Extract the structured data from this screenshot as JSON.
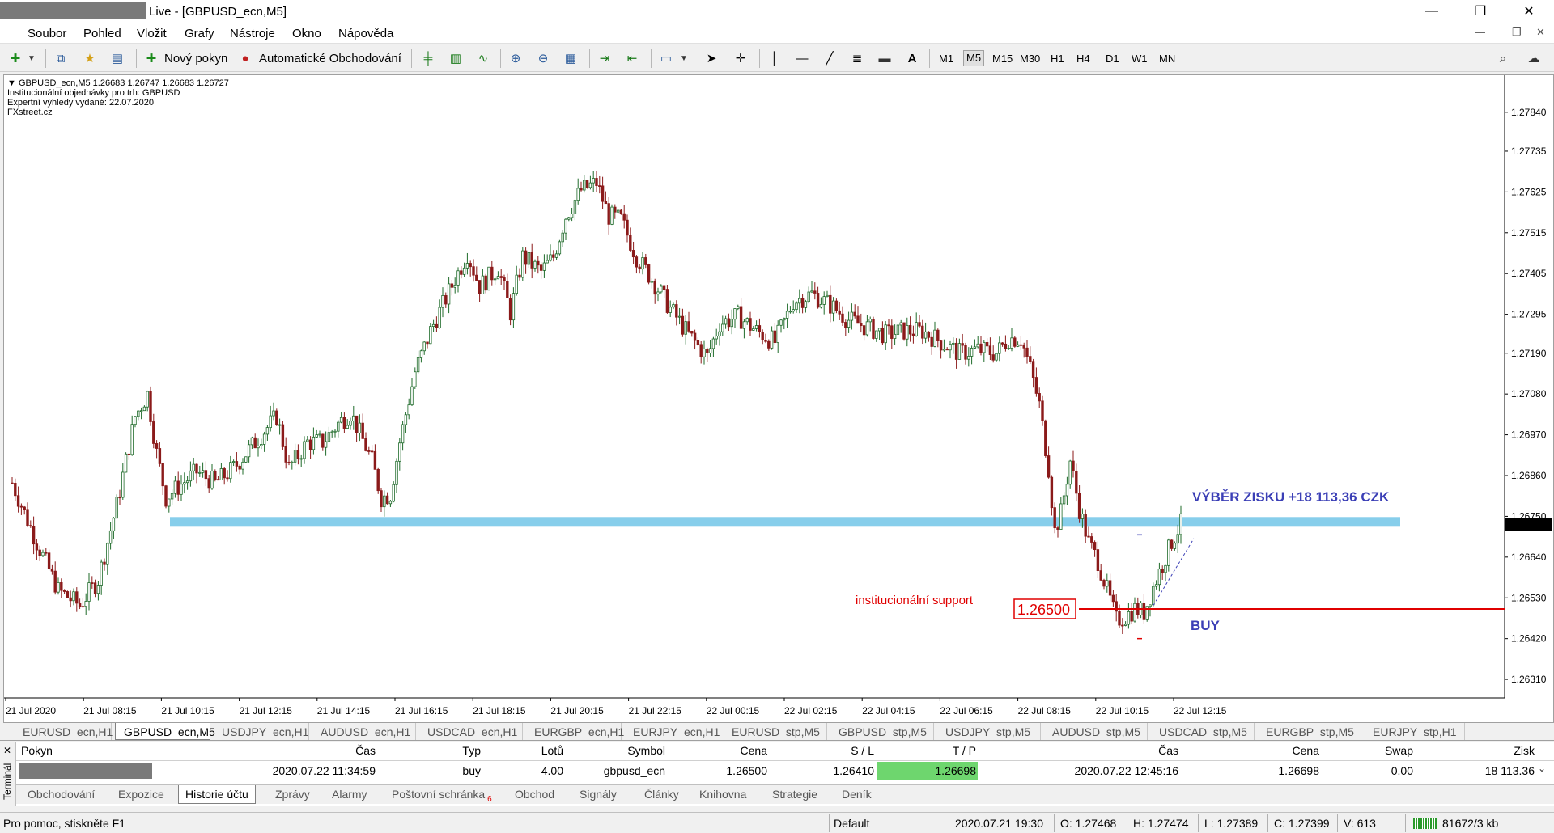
{
  "window": {
    "title": "Live - [GBPUSD_ecn,M5]",
    "minimize": "—",
    "restore": "❐",
    "close": "✕"
  },
  "menu": {
    "items": [
      "Soubor",
      "Pohled",
      "Vložit",
      "Grafy",
      "Nástroje",
      "Okno",
      "Nápověda"
    ],
    "mdi": [
      "—",
      "❐",
      "✕"
    ]
  },
  "toolbar": {
    "new_order": "Nový pokyn",
    "auto_trading": "Automatické Obchodování",
    "timeframes": [
      "M1",
      "M5",
      "M15",
      "M30",
      "H1",
      "H4",
      "D1",
      "W1",
      "MN"
    ],
    "active_timeframe": "M5",
    "text_tool": "A"
  },
  "chart": {
    "header": "GBPUSD_ecn,M5  1.26683 1.26747 1.26683 1.26727",
    "info_lines": [
      "Institucionální objednávky pro trh: GBPUSD",
      "Expertní výhledy vydané: 22.07.2020",
      "FXstreet.cz"
    ],
    "current_price": "1.26727",
    "support_label": "institucionální support",
    "support_price": "1.26500",
    "buy_label": "BUY",
    "profit_label": "VÝBĚR ZISKU +18 113,36 CZK",
    "colors": {
      "bull": "#1f6b2a",
      "bear": "#8b1a1a",
      "support_line": "#e00000",
      "zone": "#87ceeb",
      "annotation_blue": "#3b3fb6"
    }
  },
  "chart_data": {
    "type": "candlestick",
    "symbol": "GBPUSD_ecn",
    "timeframe": "M5",
    "ylim": [
      1.2626,
      1.2794
    ],
    "y_ticks": [
      "1.27840",
      "1.27735",
      "1.27625",
      "1.27515",
      "1.27405",
      "1.27295",
      "1.27190",
      "1.27080",
      "1.26970",
      "1.26860",
      "1.26750",
      "1.26640",
      "1.26530",
      "1.26420",
      "1.26310"
    ],
    "x_ticks": [
      "21 Jul 2020",
      "21 Jul 08:15",
      "21 Jul 10:15",
      "21 Jul 12:15",
      "21 Jul 14:15",
      "21 Jul 16:15",
      "21 Jul 18:15",
      "21 Jul 20:15",
      "21 Jul 22:15",
      "22 Jul 00:15",
      "22 Jul 02:15",
      "22 Jul 04:15",
      "22 Jul 06:15",
      "22 Jul 08:15",
      "22 Jul 10:15",
      "22 Jul 12:15"
    ],
    "price_path": [
      [
        0,
        1.2684
      ],
      [
        8,
        1.2668
      ],
      [
        15,
        1.2655
      ],
      [
        22,
        1.2651
      ],
      [
        28,
        1.2658
      ],
      [
        34,
        1.2678
      ],
      [
        40,
        1.2702
      ],
      [
        44,
        1.2708
      ],
      [
        47,
        1.2692
      ],
      [
        50,
        1.268
      ],
      [
        54,
        1.2683
      ],
      [
        60,
        1.2687
      ],
      [
        66,
        1.2684
      ],
      [
        72,
        1.2688
      ],
      [
        80,
        1.2696
      ],
      [
        86,
        1.2702
      ],
      [
        90,
        1.2688
      ],
      [
        96,
        1.2695
      ],
      [
        101,
        1.2695
      ],
      [
        106,
        1.27
      ],
      [
        110,
        1.2703
      ],
      [
        117,
        1.269
      ],
      [
        120,
        1.268
      ],
      [
        123,
        1.2681
      ],
      [
        126,
        1.2695
      ],
      [
        131,
        1.2714
      ],
      [
        136,
        1.2725
      ],
      [
        140,
        1.2732
      ],
      [
        148,
        1.2746
      ],
      [
        152,
        1.2737
      ],
      [
        158,
        1.2742
      ],
      [
        162,
        1.273
      ],
      [
        166,
        1.2745
      ],
      [
        172,
        1.2741
      ],
      [
        176,
        1.2745
      ],
      [
        180,
        1.2756
      ],
      [
        185,
        1.2763
      ],
      [
        190,
        1.2765
      ],
      [
        194,
        1.2756
      ],
      [
        198,
        1.2755
      ],
      [
        203,
        1.2745
      ],
      [
        208,
        1.2739
      ],
      [
        214,
        1.2731
      ],
      [
        220,
        1.2724
      ],
      [
        226,
        1.2718
      ],
      [
        230,
        1.2727
      ],
      [
        236,
        1.2729
      ],
      [
        242,
        1.2725
      ],
      [
        248,
        1.2722
      ],
      [
        254,
        1.2733
      ],
      [
        260,
        1.2735
      ],
      [
        266,
        1.2732
      ],
      [
        272,
        1.2728
      ],
      [
        278,
        1.2726
      ],
      [
        284,
        1.2724
      ],
      [
        290,
        1.2725
      ],
      [
        296,
        1.2725
      ],
      [
        302,
        1.2722
      ],
      [
        308,
        1.2719
      ],
      [
        314,
        1.272
      ],
      [
        320,
        1.2719
      ],
      [
        324,
        1.2723
      ],
      [
        328,
        1.2723
      ],
      [
        331,
        1.2715
      ],
      [
        334,
        1.2705
      ],
      [
        337,
        1.2688
      ],
      [
        339,
        1.2671
      ],
      [
        341,
        1.2676
      ],
      [
        344,
        1.269
      ],
      [
        347,
        1.2677
      ],
      [
        350,
        1.2668
      ],
      [
        353,
        1.2663
      ],
      [
        356,
        1.2655
      ],
      [
        359,
        1.2647
      ],
      [
        362,
        1.2648
      ],
      [
        365,
        1.265
      ],
      [
        368,
        1.2649
      ],
      [
        371,
        1.2656
      ],
      [
        374,
        1.2662
      ],
      [
        377,
        1.2668
      ],
      [
        380,
        1.2673
      ]
    ],
    "annotations": [
      {
        "text": "institucionální support",
        "price": 1.265
      },
      {
        "text": "VÝBĚR ZISKU +18 113,36 CZK",
        "price": 1.26698
      },
      {
        "text": "BUY",
        "price": 1.265
      }
    ]
  },
  "chart_tabs": [
    "EURUSD_ecn,H1",
    "GBPUSD_ecn,M5",
    "USDJPY_ecn,H1",
    "AUDUSD_ecn,H1",
    "USDCAD_ecn,H1",
    "EURGBP_ecn,H1",
    "EURJPY_ecn,H1",
    "EURUSD_stp,M5",
    "GBPUSD_stp,M5",
    "USDJPY_stp,M5",
    "AUDUSD_stp,M5",
    "USDCAD_stp,M5",
    "EURGBP_stp,M5",
    "EURJPY_stp,H1"
  ],
  "chart_tabs_active": 1,
  "terminal": {
    "side_label": "Terminál",
    "headers": {
      "order": "Pokyn",
      "time": "Čas",
      "type": "Typ",
      "lots": "Lotů",
      "symbol": "Symbol",
      "price": "Cena",
      "sl": "S / L",
      "tp": "T / P",
      "time2": "Čas",
      "price2": "Cena",
      "swap": "Swap",
      "profit": "Zisk"
    },
    "row": {
      "time": "2020.07.22 11:34:59",
      "type": "buy",
      "lots": "4.00",
      "symbol": "gbpusd_ecn",
      "price": "1.26500",
      "sl": "1.26410",
      "tp": "1.26698",
      "time2": "2020.07.22 12:45:16",
      "price2": "1.26698",
      "swap": "0.00",
      "profit": "18 113.36"
    },
    "tp_color": "#6ed66e",
    "tabs": [
      "Obchodování",
      "Expozice",
      "Historie účtu",
      "Zprávy",
      "Alarmy",
      "Poštovní schránka",
      "Obchod",
      "Signály",
      "Články",
      "Knihovna",
      "Strategie",
      "Deník"
    ],
    "mailbox_count": "6",
    "active_tab": 2
  },
  "status": {
    "help": "Pro pomoc, stiskněte F1",
    "profile": "Default",
    "datetime": "2020.07.21 19:30",
    "open": "O: 1.27468",
    "high": "H: 1.27474",
    "low": "L: 1.27389",
    "close": "C: 1.27399",
    "volume": "V: 613",
    "traffic": "81672/3 kb"
  }
}
